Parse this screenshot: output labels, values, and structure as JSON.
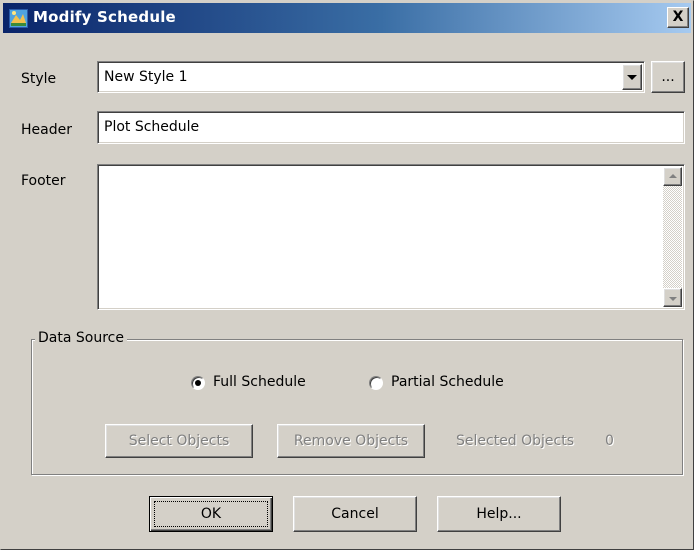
{
  "window": {
    "title": "Modify Schedule",
    "close_glyph": "X"
  },
  "style": {
    "label": "Style",
    "selected": "New Style 1",
    "browse_label": "..."
  },
  "header": {
    "label": "Header",
    "value": "Plot Schedule"
  },
  "footer": {
    "label": "Footer",
    "value": ""
  },
  "data_source": {
    "legend": "Data Source",
    "options": [
      {
        "label": "Full Schedule",
        "selected": true
      },
      {
        "label": "Partial Schedule",
        "selected": false
      }
    ],
    "select_objects_label": "Select Objects",
    "remove_objects_label": "Remove Objects",
    "selected_objects_label": "Selected Objects",
    "selected_objects_count": "0"
  },
  "buttons": {
    "ok": "OK",
    "cancel": "Cancel",
    "help": "Help..."
  },
  "colors": {
    "face": "#d4d0c8",
    "titlebar_start": "#0a246a",
    "titlebar_end": "#a6caf0"
  },
  "icons": {
    "app": "app-icon",
    "close": "close-icon",
    "dropdown": "chevron-down-icon"
  }
}
